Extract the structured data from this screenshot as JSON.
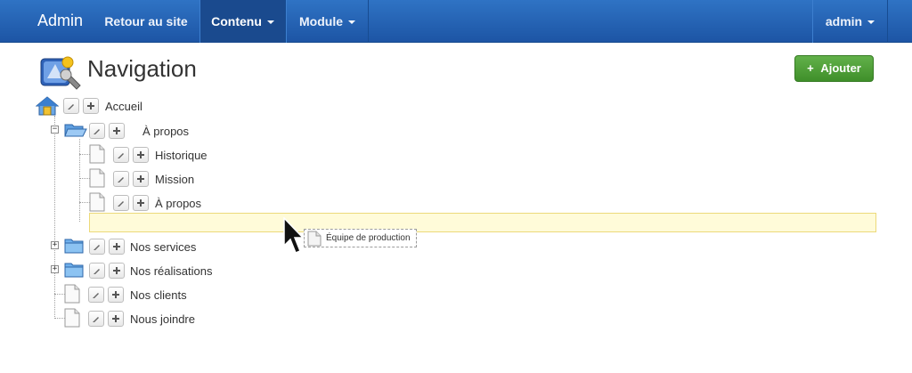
{
  "navbar": {
    "brand": "Admin",
    "items": [
      {
        "label": "Retour au site",
        "dropdown": false,
        "active": false
      },
      {
        "label": "Contenu",
        "dropdown": true,
        "active": true
      },
      {
        "label": "Module",
        "dropdown": true,
        "active": false
      }
    ],
    "user": {
      "label": "admin",
      "dropdown": true
    }
  },
  "page": {
    "title": "Navigation",
    "add_button_label": "Ajouter",
    "title_icon": "navigation-compass-icon"
  },
  "tree": {
    "root": {
      "label": "Accueil",
      "icon": "home-icon"
    },
    "items": [
      {
        "label": "À propos",
        "type": "folder",
        "expanded": true,
        "children": [
          {
            "label": "Historique",
            "type": "page"
          },
          {
            "label": "Mission",
            "type": "page"
          },
          {
            "label": "À propos",
            "type": "page"
          }
        ]
      },
      {
        "label": "Nos services",
        "type": "folder",
        "expanded": false
      },
      {
        "label": "Nos réalisations",
        "type": "folder",
        "expanded": false
      },
      {
        "label": "Nos clients",
        "type": "page"
      },
      {
        "label": "Nous joindre",
        "type": "page"
      }
    ]
  },
  "drag": {
    "label": "Équipe de production"
  },
  "colors": {
    "navbar": "#2f73c4",
    "accent_green": "#4ea13a",
    "placeholder": "#fffbd9"
  }
}
